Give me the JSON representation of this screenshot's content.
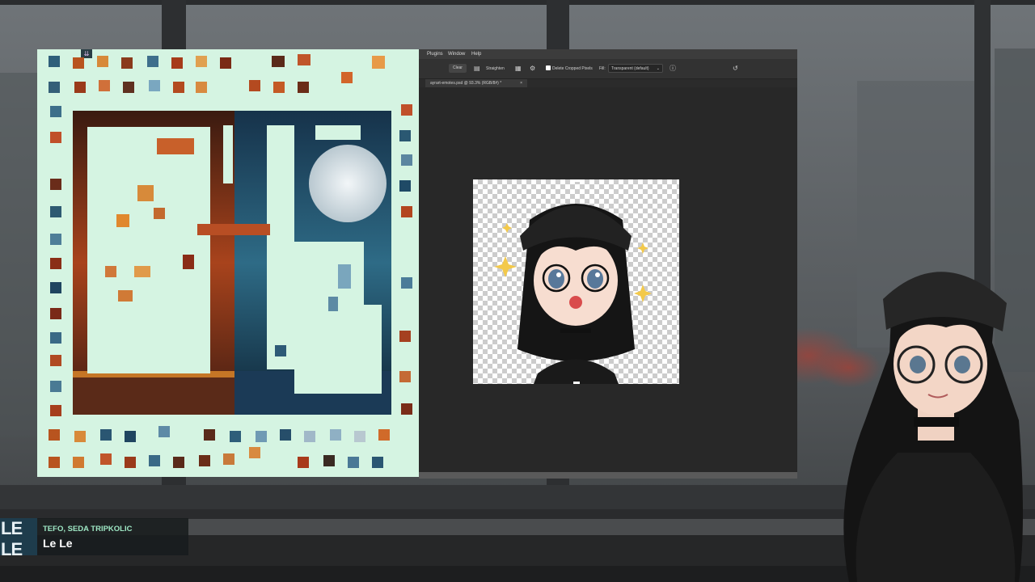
{
  "colors": {
    "board_bg": "#d5f4e2",
    "photoshop_bg": "#282828",
    "music_artist": "#9ee7c4",
    "music_title": "#ffffff"
  },
  "puzzle": {
    "collapse_icon": "chevron-double-down-icon"
  },
  "photoshop": {
    "menu": [
      "Plugins",
      "Window",
      "Help"
    ],
    "options": {
      "clear": "Clear",
      "straighten": "Straighten",
      "delete_cropped": "Delete Cropped Pixels",
      "fill_label": "Fill:",
      "fill_value": "Transparent (default)"
    },
    "tab": "ayrart-emotes.psd @ 93.3% (RGB/8#) *",
    "tab_close": "×"
  },
  "now_playing": {
    "cover_text": "LE LE",
    "artist": "TEFO, SEDA TRIPKOLIC",
    "title": "Le Le"
  }
}
